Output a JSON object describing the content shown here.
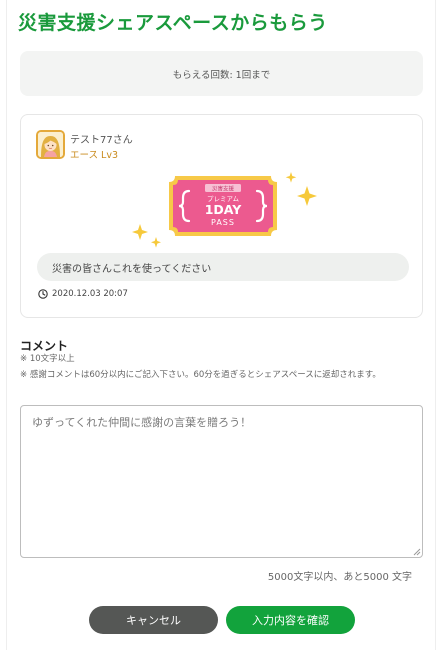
{
  "page": {
    "title": "災害支援シェアスペースからもらう"
  },
  "limit": {
    "text": "もらえる回数: 1回まで"
  },
  "post": {
    "user_name": "テスト77さん",
    "user_rank": "エース Lv3",
    "ticket": {
      "badge": "災害支援",
      "line1": "プレミアム",
      "line2": "1DAY",
      "line3": "PASS"
    },
    "message": "災害の皆さんこれを使ってください",
    "date": "2020.12.03 20:07"
  },
  "comment": {
    "heading": "コメント",
    "notes": [
      "※ 10文字以上",
      "※ 感謝コメントは60分以内にご記入下さい。60分を過ぎるとシェアスペースに返却されます。"
    ],
    "placeholder": "ゆずってくれた仲間に感謝の言葉を贈ろう！",
    "counter": "5000文字以内、あと5000 文字"
  },
  "actions": {
    "cancel_label": "キャンセル",
    "confirm_label": "入力内容を確認"
  },
  "colors": {
    "brand_green": "#1a9a3c",
    "confirm_green": "#12a33c",
    "cancel_gray": "#555755",
    "rank_gold": "#c98b1e",
    "ticket_pink": "#ec5a8f",
    "ticket_gold": "#f5c644"
  },
  "icons": {
    "avatar": "avatar-girl-icon",
    "clock": "clock-icon",
    "sparkle": "sparkle-icon"
  }
}
